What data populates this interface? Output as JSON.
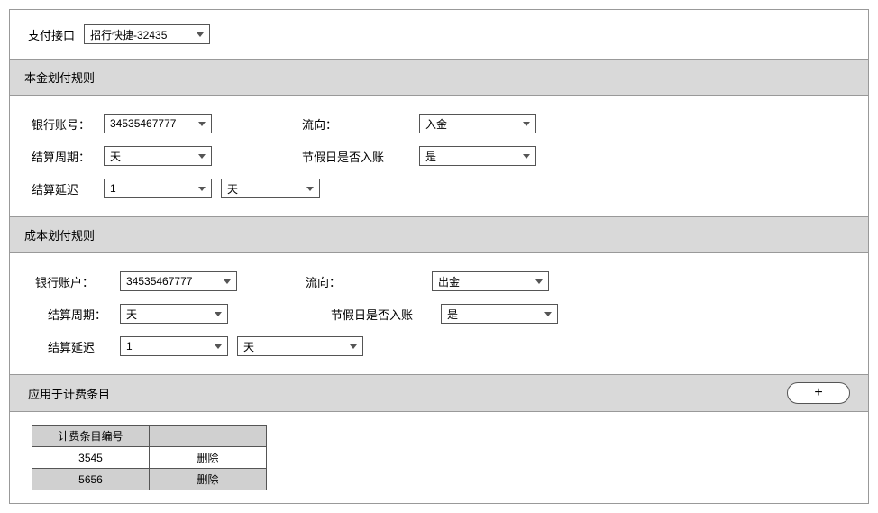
{
  "top": {
    "pay_interface_label": "支付接口",
    "pay_interface_value": "招行快捷-32435"
  },
  "section1_header": "本金划付规则",
  "section1": {
    "bank_account_label": "银行账号：",
    "bank_account_value": "34535467777",
    "direction_label": "流向：",
    "direction_value": "入金",
    "settle_cycle_label": "结算周期：",
    "settle_cycle_value": "天",
    "holiday_label": "节假日是否入账",
    "holiday_value": "是",
    "settle_delay_label": "结算延迟",
    "settle_delay_value": "1",
    "settle_delay_unit": "天"
  },
  "section2_header": "成本划付规则",
  "section2": {
    "bank_account_label": "银行账户：",
    "bank_account_value": "34535467777",
    "direction_label": "流向：",
    "direction_value": "出金",
    "settle_cycle_label": "结算周期：",
    "settle_cycle_value": "天",
    "holiday_label": "节假日是否入账",
    "holiday_value": "是",
    "settle_delay_label": "结算延迟",
    "settle_delay_value": "1",
    "settle_delay_unit": "天"
  },
  "section3_header": "应用于计费条目",
  "add_button": "+",
  "table": {
    "col_id": "计费条目编号",
    "col_action": "",
    "rows": [
      {
        "id": "3545",
        "action": "删除"
      },
      {
        "id": "5656",
        "action": "删除"
      }
    ]
  }
}
